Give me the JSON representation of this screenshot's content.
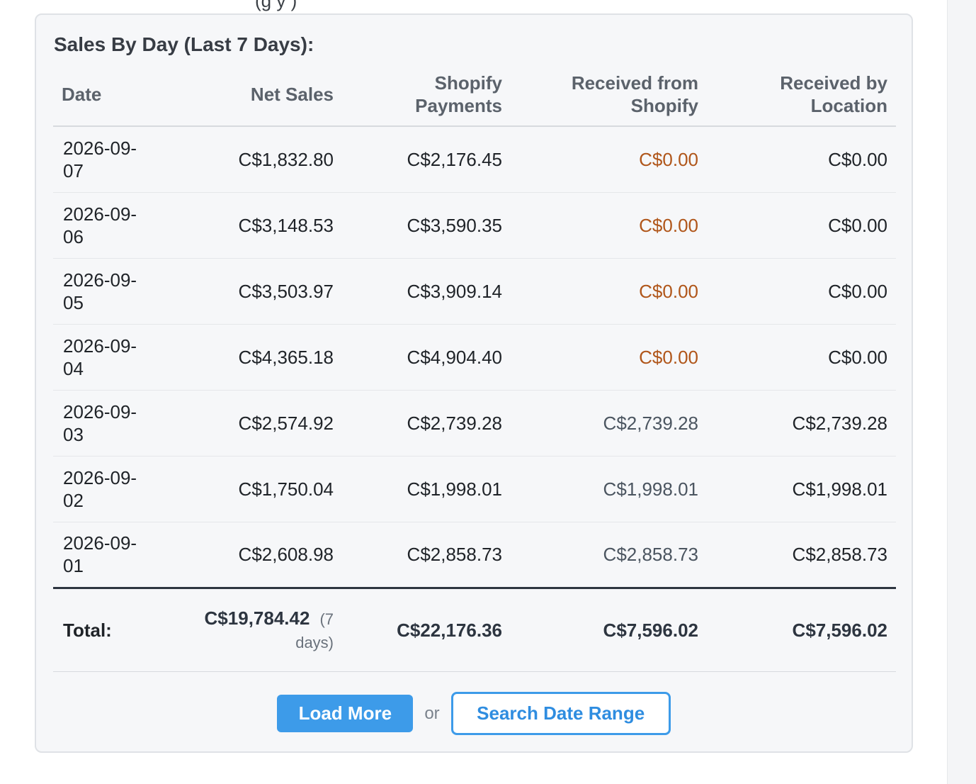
{
  "header_clip": "(g                 y                                    )",
  "card": {
    "title": "Sales By Day (Last 7 Days):"
  },
  "table": {
    "headers": {
      "date": "Date",
      "net_sales": "Net Sales",
      "shopify_payments_line1": "Shopify",
      "shopify_payments_line2": "Payments",
      "received_shopify_line1": "Received from",
      "received_shopify_line2": "Shopify",
      "received_location_line1": "Received by",
      "received_location_line2": "Location"
    },
    "rows": [
      {
        "date_line1": "2026-09-",
        "date_line2": "07",
        "net": "C$1,832.80",
        "payments": "C$2,176.45",
        "received_shopify": "C$0.00",
        "received_location": "C$0.00"
      },
      {
        "date_line1": "2026-09-",
        "date_line2": "06",
        "net": "C$3,148.53",
        "payments": "C$3,590.35",
        "received_shopify": "C$0.00",
        "received_location": "C$0.00"
      },
      {
        "date_line1": "2026-09-",
        "date_line2": "05",
        "net": "C$3,503.97",
        "payments": "C$3,909.14",
        "received_shopify": "C$0.00",
        "received_location": "C$0.00"
      },
      {
        "date_line1": "2026-09-",
        "date_line2": "04",
        "net": "C$4,365.18",
        "payments": "C$4,904.40",
        "received_shopify": "C$0.00",
        "received_location": "C$0.00"
      },
      {
        "date_line1": "2026-09-",
        "date_line2": "03",
        "net": "C$2,574.92",
        "payments": "C$2,739.28",
        "received_shopify": "C$2,739.28",
        "received_location": "C$2,739.28"
      },
      {
        "date_line1": "2026-09-",
        "date_line2": "02",
        "net": "C$1,750.04",
        "payments": "C$1,998.01",
        "received_shopify": "C$1,998.01",
        "received_location": "C$1,998.01"
      },
      {
        "date_line1": "2026-09-",
        "date_line2": "01",
        "net": "C$2,608.98",
        "payments": "C$2,858.73",
        "received_shopify": "C$2,858.73",
        "received_location": "C$2,858.73"
      }
    ],
    "totals": {
      "label": "Total:",
      "net": "C$19,784.42",
      "net_days_line1": "(7",
      "net_days_line2": "days)",
      "payments": "C$22,176.36",
      "received_shopify": "C$7,596.02",
      "received_location": "C$7,596.02"
    }
  },
  "actions": {
    "load_more_label": "Load More",
    "or_text": "or",
    "search_range_label": "Search Date Range"
  },
  "colors": {
    "zero_received": "#b0561a",
    "primary_button": "#3d9be9",
    "card_background": "#f6f7f9"
  }
}
